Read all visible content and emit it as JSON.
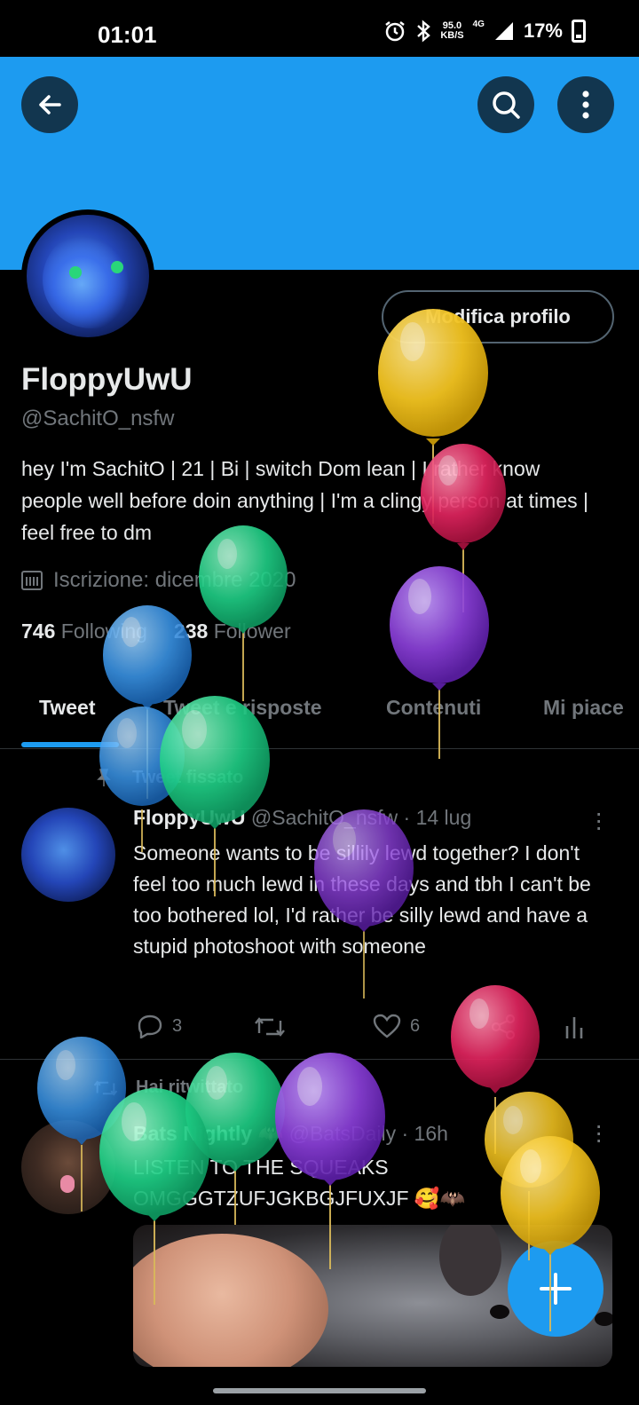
{
  "status_bar": {
    "time": "01:01",
    "speed_value": "95.0",
    "speed_unit": "KB/S",
    "network": "4G",
    "battery": "17%"
  },
  "profile": {
    "edit_button": "Modifica profilo",
    "name": "FloppyUwU",
    "handle": "@SachitO_nsfw",
    "bio": "hey I'm SachitO | 21 | Bi | switch Dom lean | I rather know people well before doin anything | I'm a clingy person at times | feel free to dm",
    "joined": "Iscrizione: dicembre 2020",
    "following_count": "746",
    "following_label": "Following",
    "followers_count": "238",
    "followers_label": "Follower"
  },
  "tabs": [
    "Tweet",
    "Tweet e risposte",
    "Contenuti",
    "Mi piace"
  ],
  "pinned_tweet": {
    "label": "Tweet fissato",
    "name": "FloppyUwU",
    "meta": "@SachitO_nsfw · 14 lug",
    "text": "Someone wants to be sillily lewd together? I don't feel too much lewd in these days and tbh I can't be too bothered lol, I'd rather be silly lewd and have a stupid photoshoot with someone",
    "replies": "3",
    "likes": "6"
  },
  "retweet": {
    "label": "Hai ritwittato",
    "name": "Bats Nightly",
    "name_emoji": "🦇",
    "meta": "@BatsDaily · 16h",
    "text": "LISTEN TO THE SQUEAKS OMGGGTZUFJGKBGJFUXJF 🥰🦇"
  },
  "colors": {
    "accent": "#1d9bf0",
    "background": "#000000",
    "secondary_text": "#71767b"
  },
  "icons": {
    "back": "arrow-left-icon",
    "search": "search-icon",
    "more": "more-vertical-icon",
    "calendar": "calendar-icon",
    "pin": "pin-icon",
    "reply": "reply-icon",
    "retweet": "retweet-icon",
    "like": "heart-icon",
    "share": "share-icon",
    "analytics": "analytics-icon",
    "compose": "plus-icon"
  },
  "decorations": {
    "balloon_colors": [
      "#f5c518",
      "#e0245e",
      "#17bf63",
      "#794bc4",
      "#1d9bf0"
    ]
  }
}
